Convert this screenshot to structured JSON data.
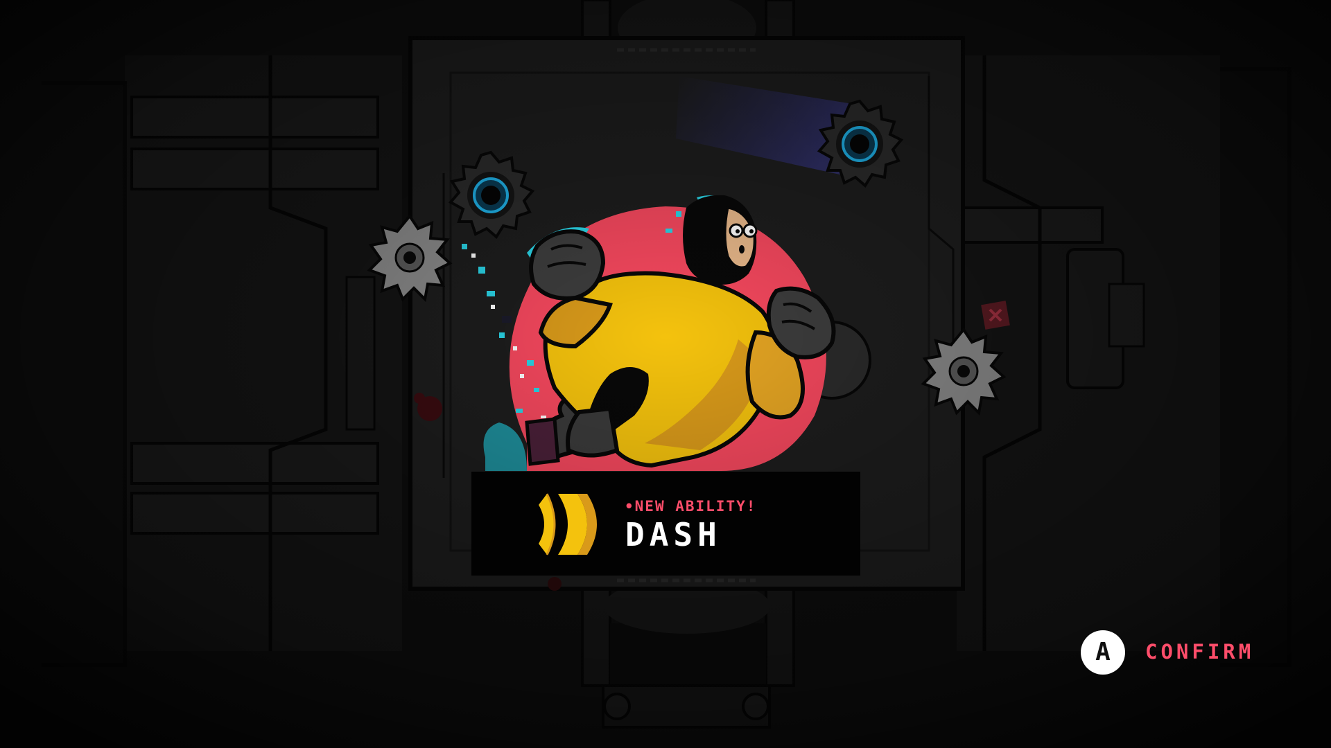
{
  "popup": {
    "kicker": "NEW ABILITY!",
    "ability_name": "DASH",
    "ability_icon": "dash-chevron-icon"
  },
  "prompt": {
    "button_glyph": "A",
    "label": "CONFIRM"
  },
  "colors": {
    "background": "#0c0c0c",
    "accent_pink": "#ff4d6a",
    "accent_yellow": "#f4c20d",
    "backdrop_red": "#f6485e",
    "glitch_cyan": "#2ad4e6",
    "banner_black": "#020202",
    "text_white": "#ffffff"
  }
}
